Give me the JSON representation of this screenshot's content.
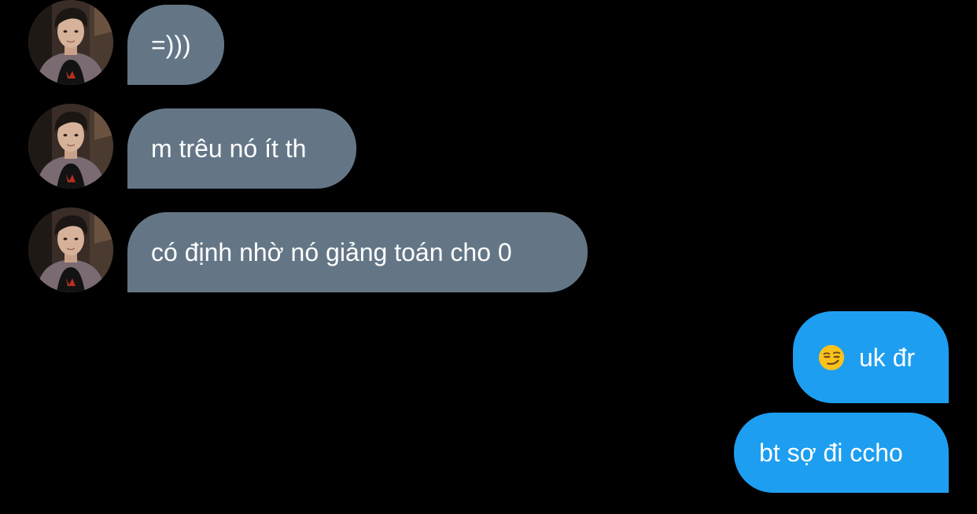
{
  "conversation": {
    "incoming": [
      {
        "text": "=)))",
        "avatar_icon": "user-avatar-photo"
      },
      {
        "text": "m trêu nó ít th",
        "avatar_icon": "user-avatar-photo"
      },
      {
        "text": "có định nhờ nó giảng toán cho 0",
        "avatar_icon": "user-avatar-photo"
      }
    ],
    "outgoing": [
      {
        "emoji": "smirking-face-emoji",
        "text": "uk đr"
      },
      {
        "text": "bt sợ đi ccho"
      }
    ]
  },
  "colors": {
    "background": "#000000",
    "incoming_bubble": "#647686",
    "outgoing_bubble": "#1e9ef0",
    "text": "#ffffff"
  }
}
